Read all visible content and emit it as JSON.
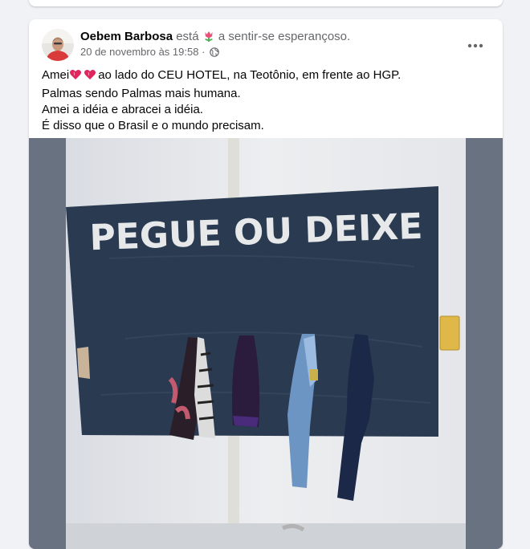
{
  "post": {
    "author": "Oebem Barbosa",
    "feeling_verb": "está",
    "feeling_icon": "tulip-emoji",
    "feeling_text": "a sentir-se esperançoso.",
    "timestamp": "20 de novembro às 19:58",
    "privacy_icon": "globe-icon",
    "text": {
      "line1_start": "Amei",
      "line1_emoji": "heart-emoji",
      "line1_rest": "ao lado do CEU HOTEL, na Teotônio, em frente ao HGP.",
      "line2": "Palmas sendo Palmas mais humana.",
      "line3": "Amei a idéia e abracei a idéia.",
      "line4": "É disso que o Brasil e o mundo precisam."
    },
    "photo": {
      "wall_text": "PEGUE OU DEIXE"
    }
  },
  "colors": {
    "page_bg": "#f0f2f5",
    "card_bg": "#ffffff",
    "secondary_text": "#65676b",
    "banner": "#2a3a51",
    "photo_letterbox": "#687281"
  }
}
